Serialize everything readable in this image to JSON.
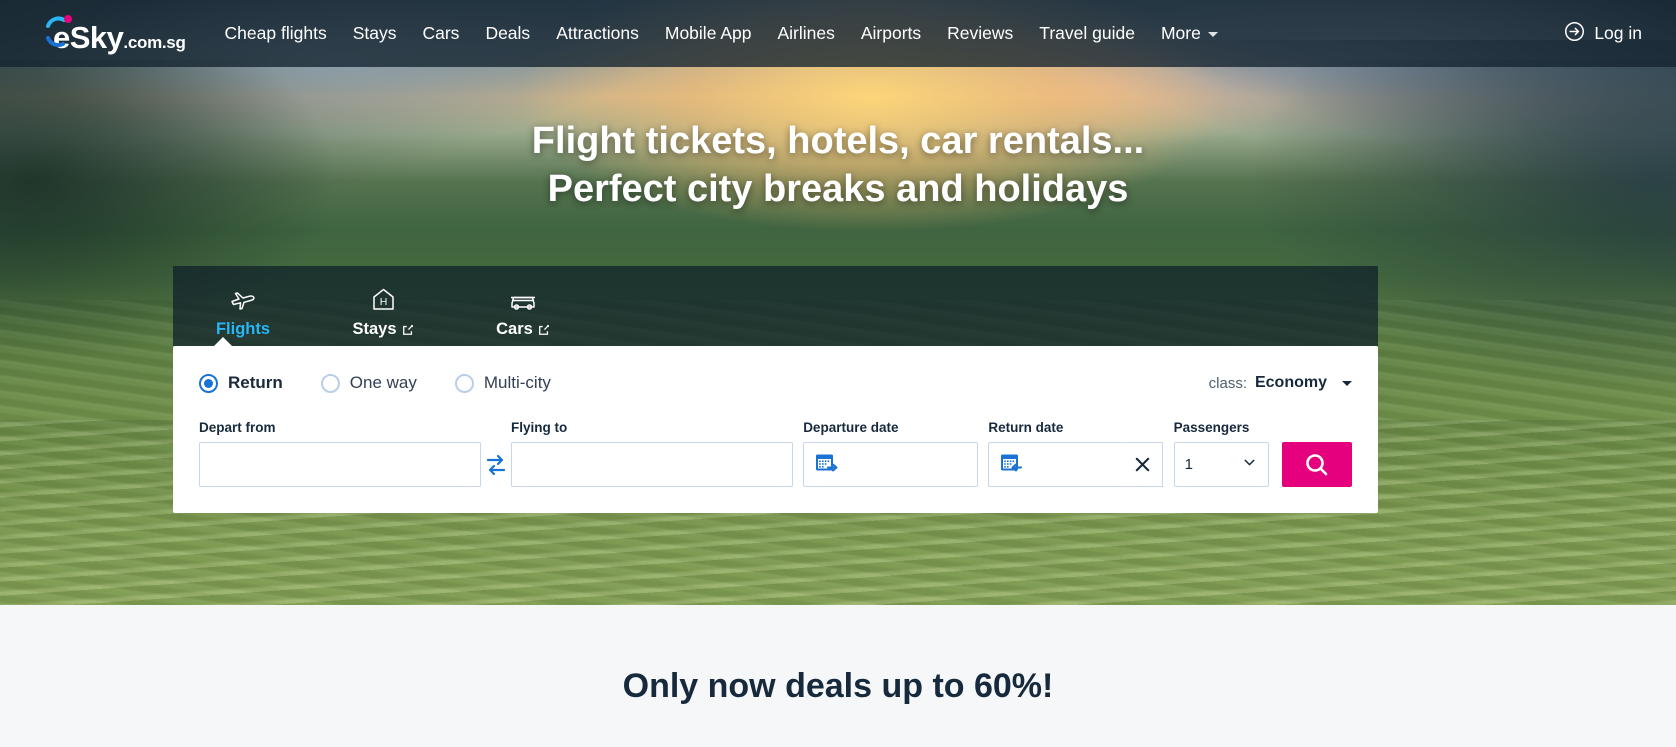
{
  "navbar": {
    "logo": {
      "brand": "eSky",
      "tld": ".com.sg"
    },
    "links": [
      {
        "label": "Cheap flights",
        "name": "nav-cheap-flights"
      },
      {
        "label": "Stays",
        "name": "nav-stays"
      },
      {
        "label": "Cars",
        "name": "nav-cars"
      },
      {
        "label": "Deals",
        "name": "nav-deals"
      },
      {
        "label": "Attractions",
        "name": "nav-attractions"
      },
      {
        "label": "Mobile App",
        "name": "nav-mobile-app"
      },
      {
        "label": "Airlines",
        "name": "nav-airlines"
      },
      {
        "label": "Airports",
        "name": "nav-airports"
      },
      {
        "label": "Reviews",
        "name": "nav-reviews"
      },
      {
        "label": "Travel guide",
        "name": "nav-travel-guide"
      },
      {
        "label": "More",
        "name": "nav-more",
        "has_caret": true
      }
    ],
    "login_label": "Log in"
  },
  "hero": {
    "heading_line1": "Flight tickets, hotels, car rentals...",
    "heading_line2": "Perfect city breaks and holidays"
  },
  "widget": {
    "tabs": [
      {
        "label": "Flights",
        "icon": "plane-icon",
        "active": true,
        "external": false
      },
      {
        "label": "Stays",
        "icon": "hotel-icon",
        "active": false,
        "external": true
      },
      {
        "label": "Cars",
        "icon": "car-icon",
        "active": false,
        "external": true
      }
    ],
    "trip_types": [
      {
        "label": "Return",
        "checked": true
      },
      {
        "label": "One way",
        "checked": false
      },
      {
        "label": "Multi-city",
        "checked": false
      }
    ],
    "class_label": "class:",
    "class_value": "Economy",
    "fields": {
      "depart_from": {
        "label": "Depart from",
        "value": "",
        "placeholder": ""
      },
      "flying_to": {
        "label": "Flying to",
        "value": "",
        "placeholder": ""
      },
      "departure_date": {
        "label": "Departure date",
        "value": ""
      },
      "return_date": {
        "label": "Return date",
        "value": ""
      },
      "passengers": {
        "label": "Passengers",
        "value": "1"
      }
    }
  },
  "below": {
    "deals_title": "Only now deals up to 60%!"
  },
  "colors": {
    "accent_pink": "#e5007d",
    "accent_blue": "#1a73d4",
    "tab_active": "#29b6f6",
    "nav_bg": "rgba(20,36,48,0.78)",
    "text_dark": "#17293c"
  }
}
